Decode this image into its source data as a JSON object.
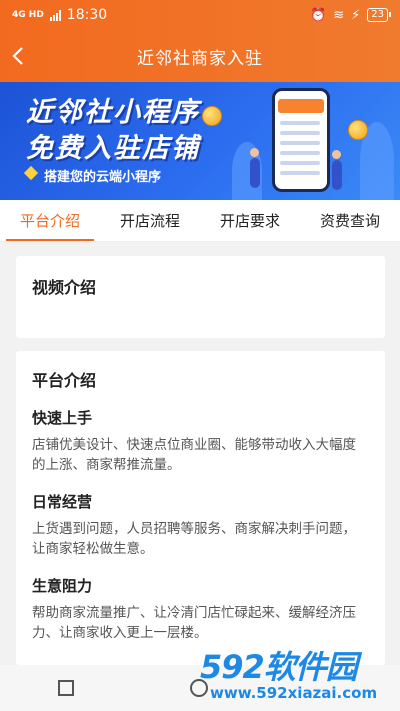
{
  "status": {
    "network": "4G HD",
    "time": "18:30",
    "battery": "23"
  },
  "header": {
    "title": "近邻社商家入驻",
    "back_icon": "chevron-left-icon"
  },
  "banner": {
    "line1": "近邻社小程序",
    "line2": "免费入驻店铺",
    "subtitle": "搭建您的云端小程序"
  },
  "tabs": [
    {
      "label": "平台介绍",
      "active": true
    },
    {
      "label": "开店流程",
      "active": false
    },
    {
      "label": "开店要求",
      "active": false
    },
    {
      "label": "资费查询",
      "active": false
    }
  ],
  "video_card": {
    "title": "视频介绍"
  },
  "platform_card": {
    "title": "平台介绍",
    "sections": [
      {
        "title": "快速上手",
        "body": "店铺优美设计、快速点位商业圈、能够带动收入大幅度的上涨、商家帮推流量。"
      },
      {
        "title": "日常经营",
        "body": "上货遇到问题，人员招聘等服务、商家解决刺手问题，让商家轻松做生意。"
      },
      {
        "title": "生意阻力",
        "body": "帮助商家流量推广、让冷清门店忙碌起来、缓解经济压力、让商家收入更上一层楼。"
      }
    ]
  },
  "watermark": {
    "logo": "592软件园",
    "url": "www.592xiazai.com"
  },
  "colors": {
    "accent": "#f06a1f",
    "banner": "#2c6df0",
    "watermark": "#1e88e5"
  }
}
